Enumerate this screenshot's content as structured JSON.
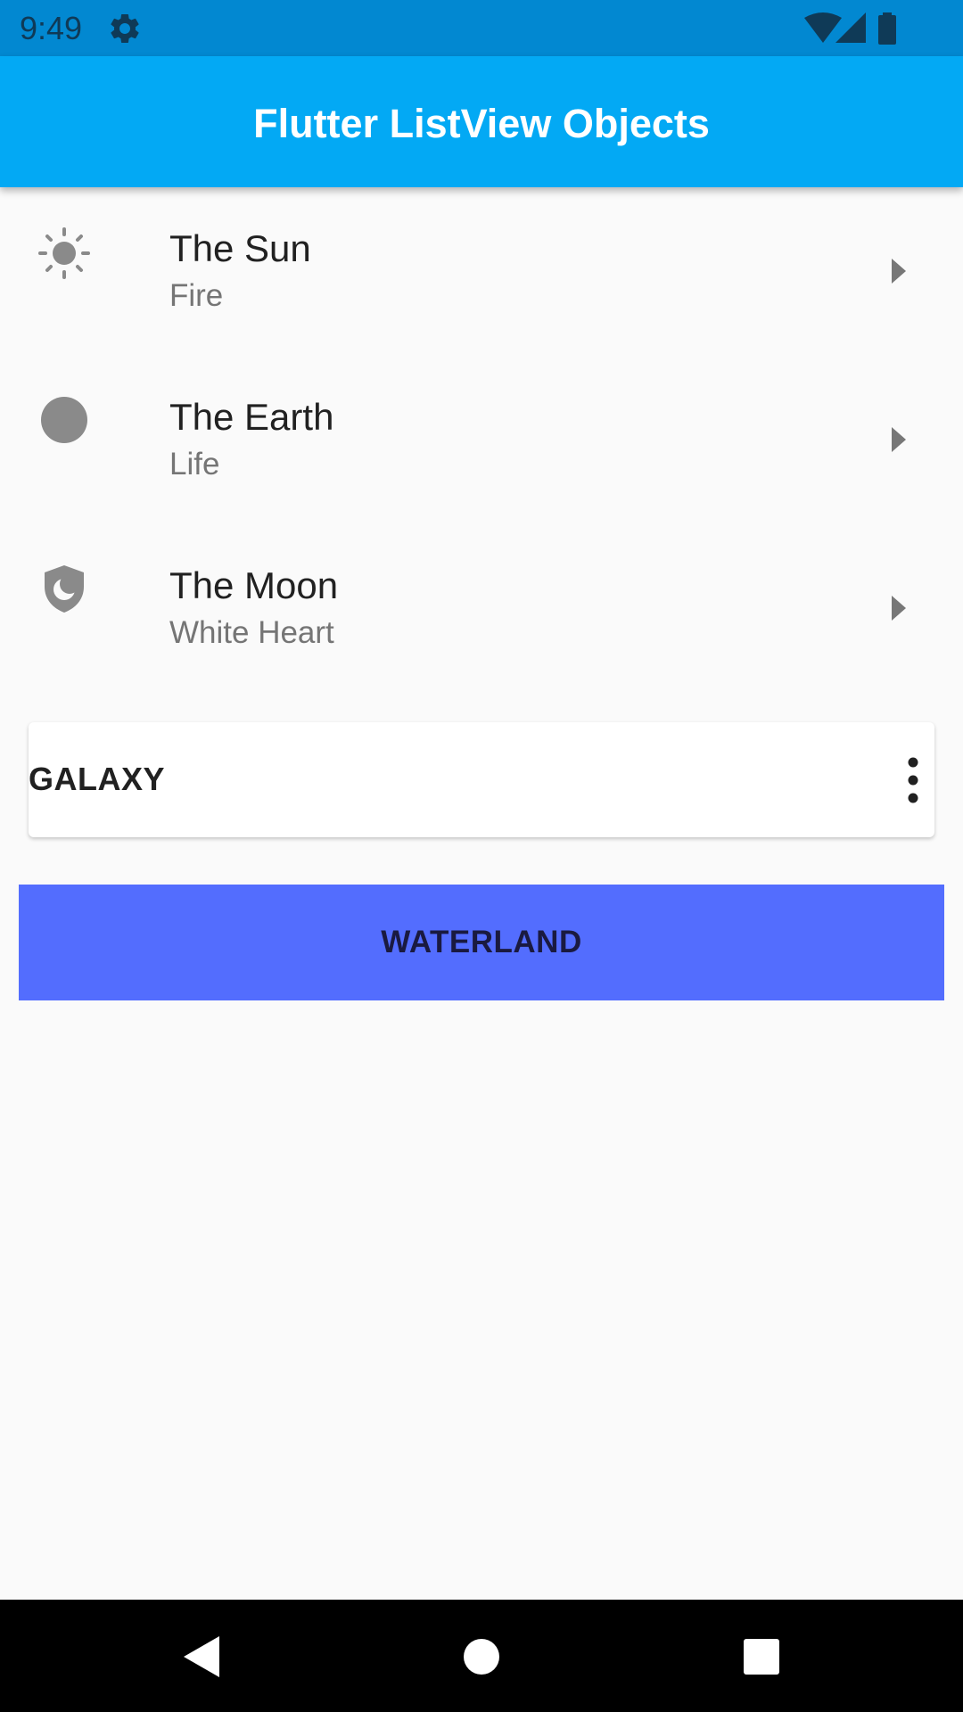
{
  "status_bar": {
    "time": "9:49",
    "icons": [
      "settings-icon",
      "wifi-icon",
      "signal-icon",
      "battery-icon"
    ]
  },
  "app_bar": {
    "title": "Flutter ListView Objects"
  },
  "list": {
    "items": [
      {
        "title": "The Sun",
        "subtitle": "Fire",
        "icon": "sun-icon"
      },
      {
        "title": "The Earth",
        "subtitle": "Life",
        "icon": "circle-icon"
      },
      {
        "title": "The Moon",
        "subtitle": "White Heart",
        "icon": "moon-shield-icon"
      }
    ]
  },
  "card": {
    "label": "GALAXY",
    "menu_icon": "more-vert-icon"
  },
  "button": {
    "label": "WATERLAND"
  },
  "nav_bar": {
    "icons": [
      "back-icon",
      "home-icon",
      "recents-icon"
    ]
  },
  "colors": {
    "status_bar": "#0288d1",
    "app_bar": "#03a9f4",
    "button": "#536dfe",
    "background": "#fafafa",
    "icon_grey": "#8a8a8a"
  }
}
